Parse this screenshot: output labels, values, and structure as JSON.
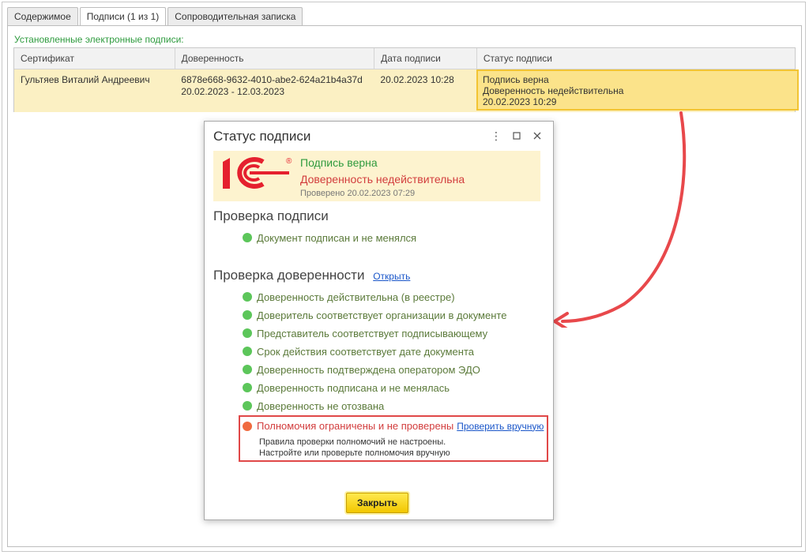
{
  "tabs": [
    {
      "label": "Содержимое"
    },
    {
      "label": "Подписи (1 из 1)"
    },
    {
      "label": "Сопроводительная записка"
    }
  ],
  "section_label": "Установленные электронные подписи:",
  "table": {
    "columns": [
      "Сертификат",
      "Доверенность",
      "Дата подписи",
      "Статус подписи"
    ],
    "row": {
      "certificate": "Гультяев Виталий Андреевич",
      "poa_id": "6878e668-9632-4010-abe2-624a21b4a37d",
      "poa_period": "20.02.2023 - 12.03.2023",
      "date": "20.02.2023 10:28",
      "status_l1": "Подпись верна",
      "status_l2": "Доверенность недействительна",
      "status_l3": "20.02.2023 10:29"
    }
  },
  "dialog": {
    "title": "Статус подписи",
    "banner": {
      "line1": "Подпись верна",
      "line2": "Доверенность недействительна",
      "line3": "Проверено 20.02.2023 07:29"
    },
    "sig_check_title": "Проверка подписи",
    "sig_checks": [
      "Документ подписан и не менялся"
    ],
    "poa_check_title": "Проверка доверенности",
    "open_link": "Открыть",
    "poa_checks": [
      "Доверенность действительна (в реестре)",
      "Доверитель соответствует организации в документе",
      "Представитель соответствует подписывающему",
      "Срок действия соответствует дате документа",
      "Доверенность подтверждена оператором ЭДО",
      "Доверенность подписана и не менялась",
      "Доверенность не отозвана"
    ],
    "warning": {
      "title": "Полномочия ограничены и не проверены",
      "link": "Проверить вручную",
      "desc1": "Правила проверки полномочий не настроены.",
      "desc2": "Настройте или проверьте полномочия вручную"
    },
    "close_button": "Закрыть"
  },
  "colors": {
    "ok": "#5cc65a",
    "error": "#f06a3f",
    "highlight": "#fbe38a",
    "arrow": "#e8484b"
  }
}
